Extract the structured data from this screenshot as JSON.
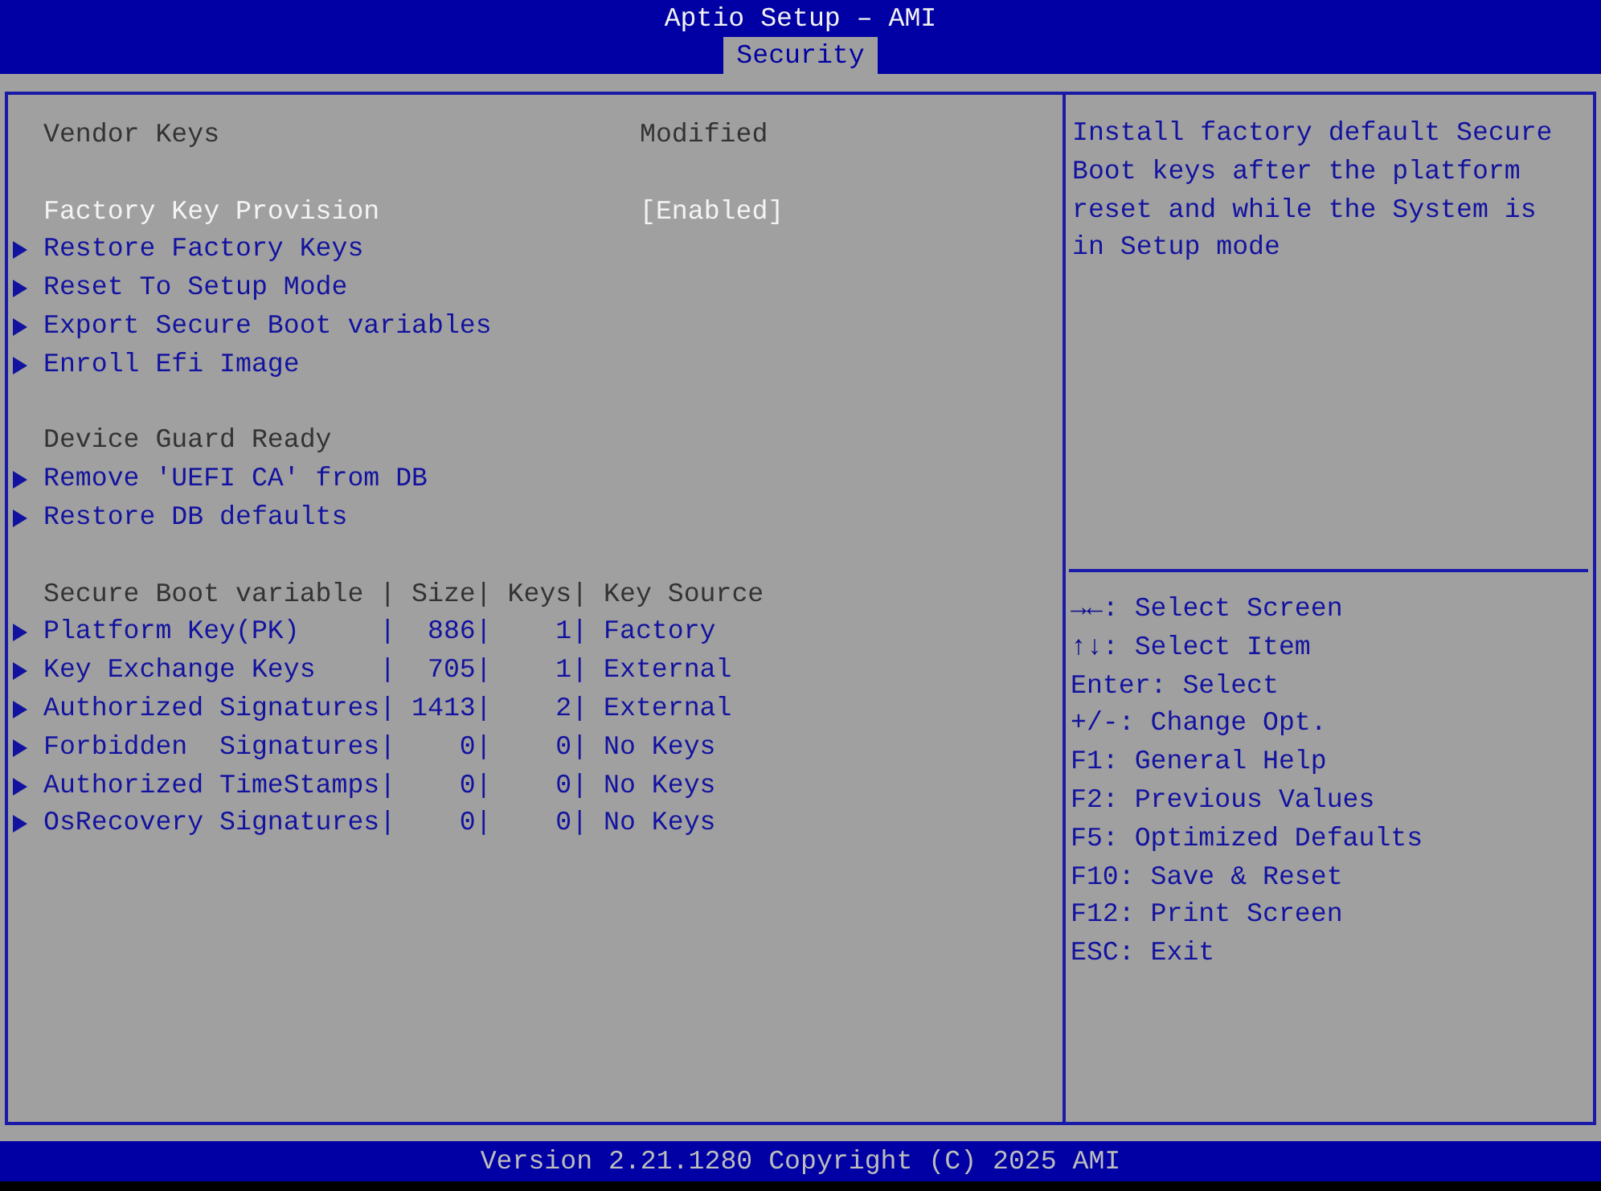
{
  "window": {
    "title": "Aptio Setup – AMI"
  },
  "tabs": [
    {
      "label": "Security",
      "selected": true
    }
  ],
  "main": {
    "items": [
      {
        "kind": "info",
        "label": "Vendor Keys",
        "value": "Modified"
      },
      {
        "kind": "blank"
      },
      {
        "kind": "setting",
        "label": "Factory Key Provision",
        "value": "[Enabled]",
        "selected": true
      },
      {
        "kind": "submenu",
        "label": "Restore Factory Keys",
        "selected": false
      },
      {
        "kind": "submenu",
        "label": "Reset To Setup Mode",
        "selected": false
      },
      {
        "kind": "submenu",
        "label": "Export Secure Boot variables",
        "selected": false
      },
      {
        "kind": "submenu",
        "label": "Enroll Efi Image",
        "selected": false
      },
      {
        "kind": "blank"
      },
      {
        "kind": "info",
        "label": "Device Guard Ready"
      },
      {
        "kind": "submenu",
        "label": "Remove 'UEFI CA' from DB",
        "selected": false
      },
      {
        "kind": "submenu",
        "label": "Restore DB defaults",
        "selected": false
      },
      {
        "kind": "blank"
      },
      {
        "kind": "info",
        "label": "Secure Boot variable | Size| Keys| Key Source"
      },
      {
        "kind": "submenu",
        "label": "Platform Key(PK)     |  886|    1| Factory",
        "selected": false
      },
      {
        "kind": "submenu",
        "label": "Key Exchange Keys    |  705|    1| External",
        "selected": false
      },
      {
        "kind": "submenu",
        "label": "Authorized Signatures| 1413|    2| External",
        "selected": false
      },
      {
        "kind": "submenu",
        "label": "Forbidden  Signatures|    0|    0| No Keys",
        "selected": false
      },
      {
        "kind": "submenu",
        "label": "Authorized TimeStamps|    0|    0| No Keys",
        "selected": false
      },
      {
        "kind": "submenu",
        "label": "OsRecovery Signatures|    0|    0| No Keys",
        "selected": false
      }
    ]
  },
  "help": {
    "description": "Install factory default Secure Boot keys after the platform reset and while the System is in Setup mode",
    "keys": [
      "**→←**: Select Screen",
      "**↑↓**: Select Item",
      "Enter: Select",
      "+/-: Change Opt.",
      "F1: General Help",
      "F2: Previous Values",
      "F5: Optimized Defaults",
      "F10: Save & Reset",
      "F12: Print Screen",
      "ESC: Exit"
    ]
  },
  "status_bar": {
    "text": "Version 2.21.1280 Copyright (C) 2025 AMI"
  }
}
